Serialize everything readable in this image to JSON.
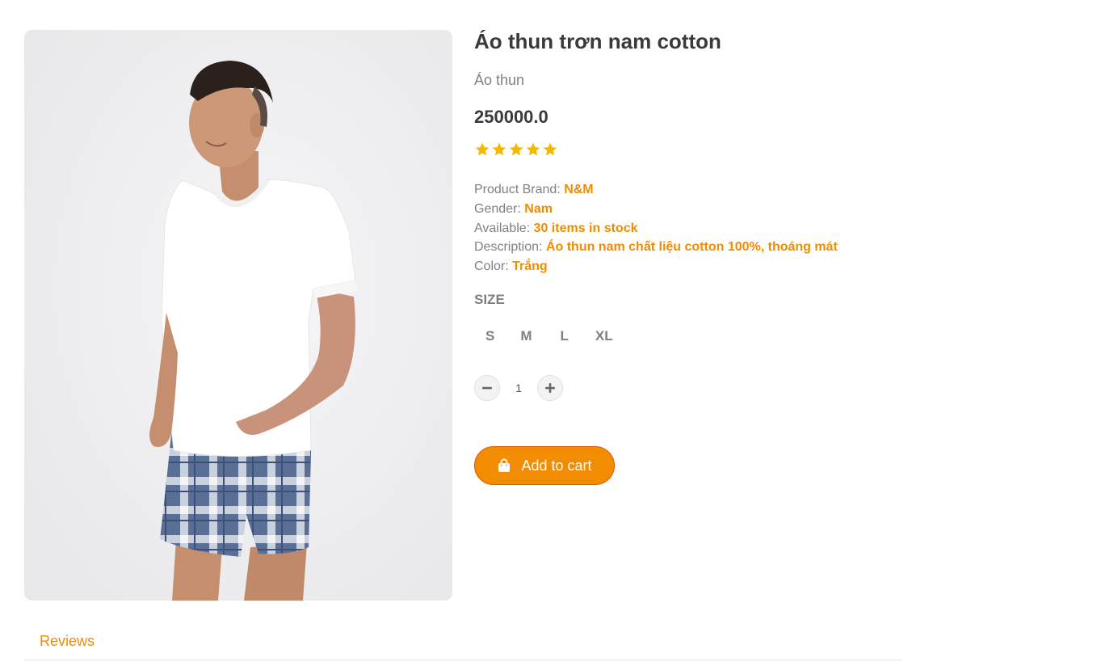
{
  "product": {
    "title": "Áo thun trơn nam cotton",
    "category": "Áo thun",
    "price": "250000.0",
    "rating": 5,
    "rating_max": 5,
    "star_color": "#f5b800",
    "image_icon": "product-photo-man-white-tshirt-plaid-shorts"
  },
  "details": {
    "brand_label": "Product Brand:",
    "brand_value": "N&M",
    "gender_label": "Gender:",
    "gender_value": "Nam",
    "available_label": "Available:",
    "available_value": "30 items in stock",
    "description_label": "Description:",
    "description_value": "Áo thun nam chất liệu cotton 100%, thoáng mát",
    "color_label": "Color:",
    "color_value": "Trắng",
    "value_color": "#f08c00"
  },
  "size": {
    "heading": "SIZE",
    "options": [
      "S",
      "M",
      "L",
      "XL"
    ]
  },
  "quantity": {
    "value": "1",
    "minus_icon": "minus-icon",
    "plus_icon": "plus-icon"
  },
  "cart": {
    "label": "Add to cart",
    "icon": "shopping-bag-icon",
    "button_color": "#f28c00"
  },
  "tabs": {
    "reviews_label": "Reviews"
  }
}
